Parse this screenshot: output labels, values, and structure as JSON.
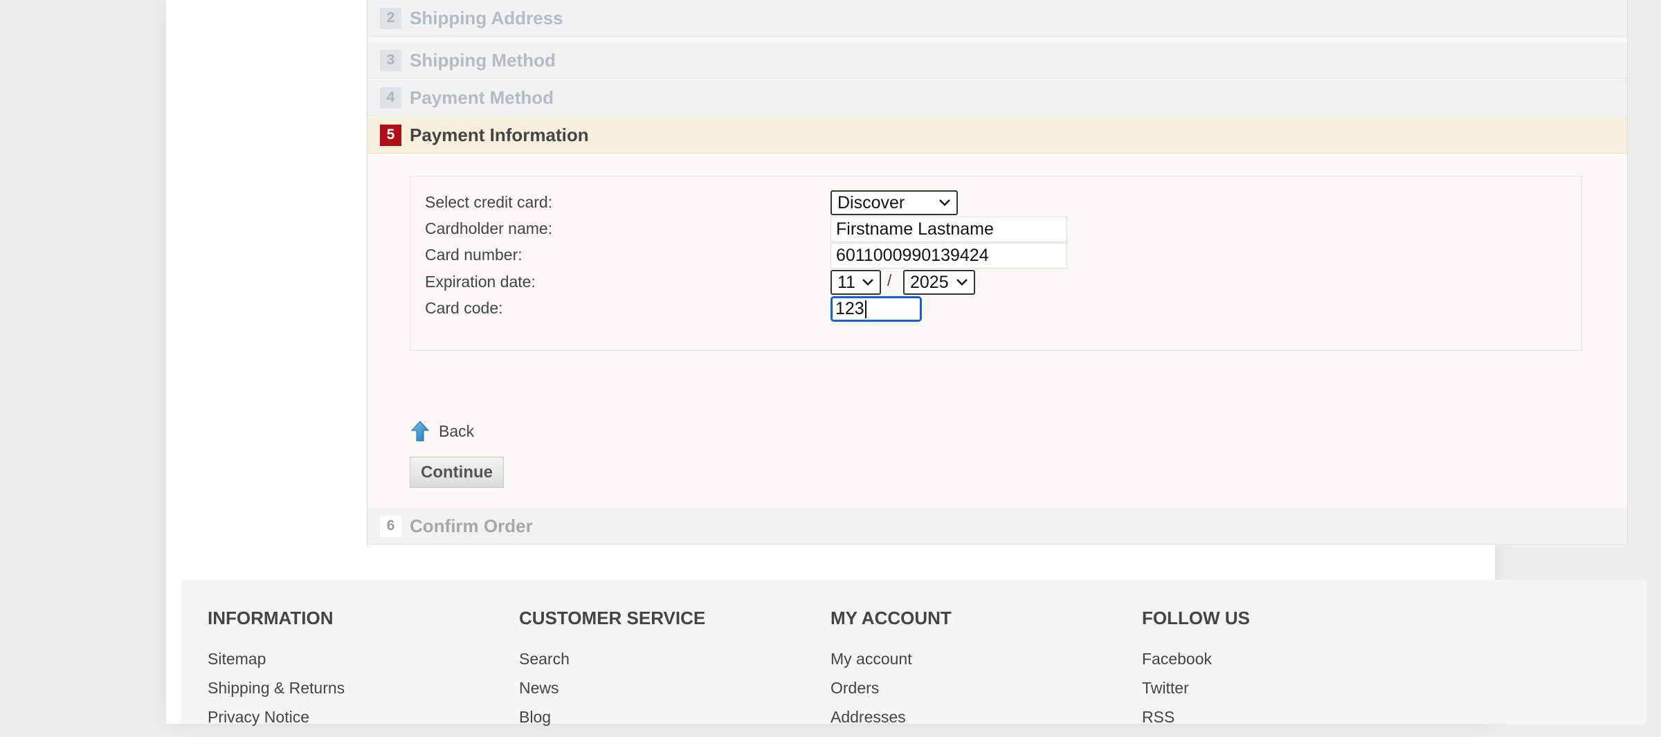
{
  "checkout_steps": [
    {
      "number": "2",
      "title": "Shipping Address"
    },
    {
      "number": "3",
      "title": "Shipping Method"
    },
    {
      "number": "4",
      "title": "Payment Method"
    },
    {
      "number": "5",
      "title": "Payment Information"
    },
    {
      "number": "6",
      "title": "Confirm Order"
    }
  ],
  "payment_info": {
    "credit_card_label": "Select credit card:",
    "credit_card_value": "Discover",
    "cardholder_label": "Cardholder name:",
    "cardholder_value": "Firstname Lastname",
    "card_number_label": "Card number:",
    "card_number_value": "6011000990139424",
    "expiration_label": "Expiration date:",
    "expiration_month": "11",
    "expiration_separator": "/",
    "expiration_year": "2025",
    "card_code_label": "Card code:",
    "card_code_value": "123"
  },
  "actions": {
    "back_label": "Back",
    "continue_label": "Continue"
  },
  "footer": {
    "columns": [
      {
        "title": "INFORMATION",
        "links": [
          "Sitemap",
          "Shipping & Returns",
          "Privacy Notice"
        ]
      },
      {
        "title": "CUSTOMER SERVICE",
        "links": [
          "Search",
          "News",
          "Blog"
        ]
      },
      {
        "title": "MY ACCOUNT",
        "links": [
          "My account",
          "Orders",
          "Addresses"
        ]
      },
      {
        "title": "FOLLOW US",
        "links": [
          "Facebook",
          "Twitter",
          "RSS"
        ]
      }
    ]
  },
  "colors": {
    "active_step_badge": "#b00f17",
    "active_step_background": "#f8f0df",
    "focus_ring": "#1a5fcf"
  },
  "icons": {
    "back": "up-arrow-icon",
    "select_chevron": "chevron-down-icon"
  }
}
